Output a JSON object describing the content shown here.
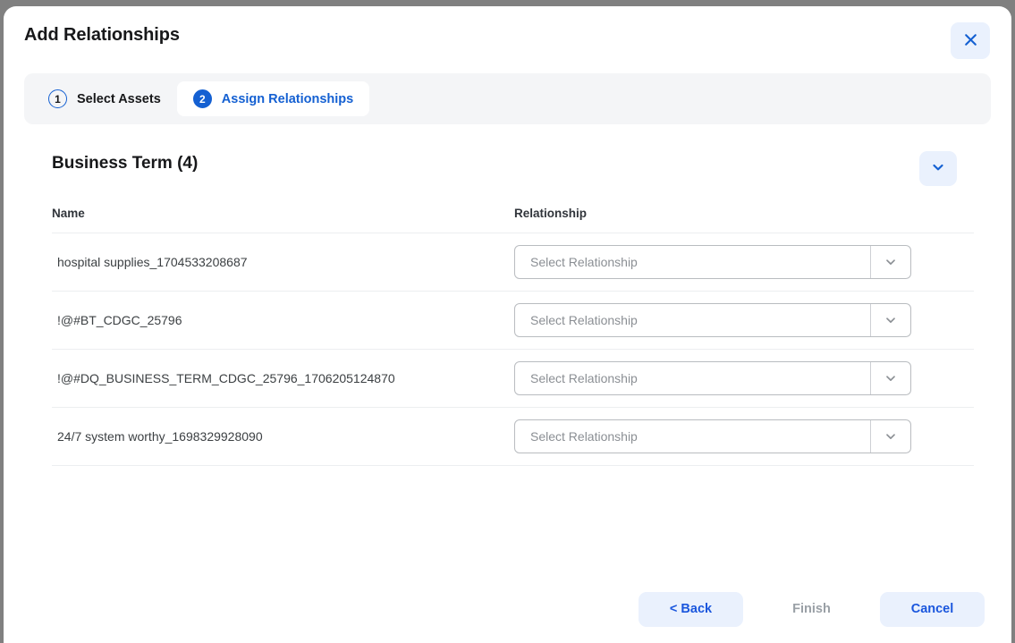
{
  "dialog": {
    "title": "Add Relationships",
    "close_icon": "close-icon"
  },
  "stepper": {
    "steps": [
      {
        "number": "1",
        "label": "Select Assets",
        "active": false
      },
      {
        "number": "2",
        "label": "Assign Relationships",
        "active": true
      }
    ]
  },
  "section": {
    "title": "Business Term (4)",
    "collapse_icon": "chevron-down-icon"
  },
  "table": {
    "columns": [
      "Name",
      "Relationship"
    ],
    "rows": [
      {
        "name": "hospital supplies_1704533208687",
        "relationship": "",
        "placeholder": "Select Relationship"
      },
      {
        "name": "!@#BT_CDGC_25796",
        "relationship": "",
        "placeholder": "Select Relationship"
      },
      {
        "name": "!@#DQ_BUSINESS_TERM_CDGC_25796_1706205124870",
        "relationship": "",
        "placeholder": "Select Relationship"
      },
      {
        "name": "24/7 system worthy_1698329928090",
        "relationship": "",
        "placeholder": "Select Relationship"
      }
    ]
  },
  "footer": {
    "back_label": "< Back",
    "finish_label": "Finish",
    "cancel_label": "Cancel"
  },
  "colors": {
    "accent": "#1460d2",
    "accent_soft": "#eaf1fd",
    "backdrop": "#808080",
    "text": "#17181a",
    "muted": "#8b8f94",
    "disabled": "#9aa0a6",
    "border": "#b9bcc0",
    "divider": "#eceef0",
    "stepper_track": "#f4f5f7"
  }
}
